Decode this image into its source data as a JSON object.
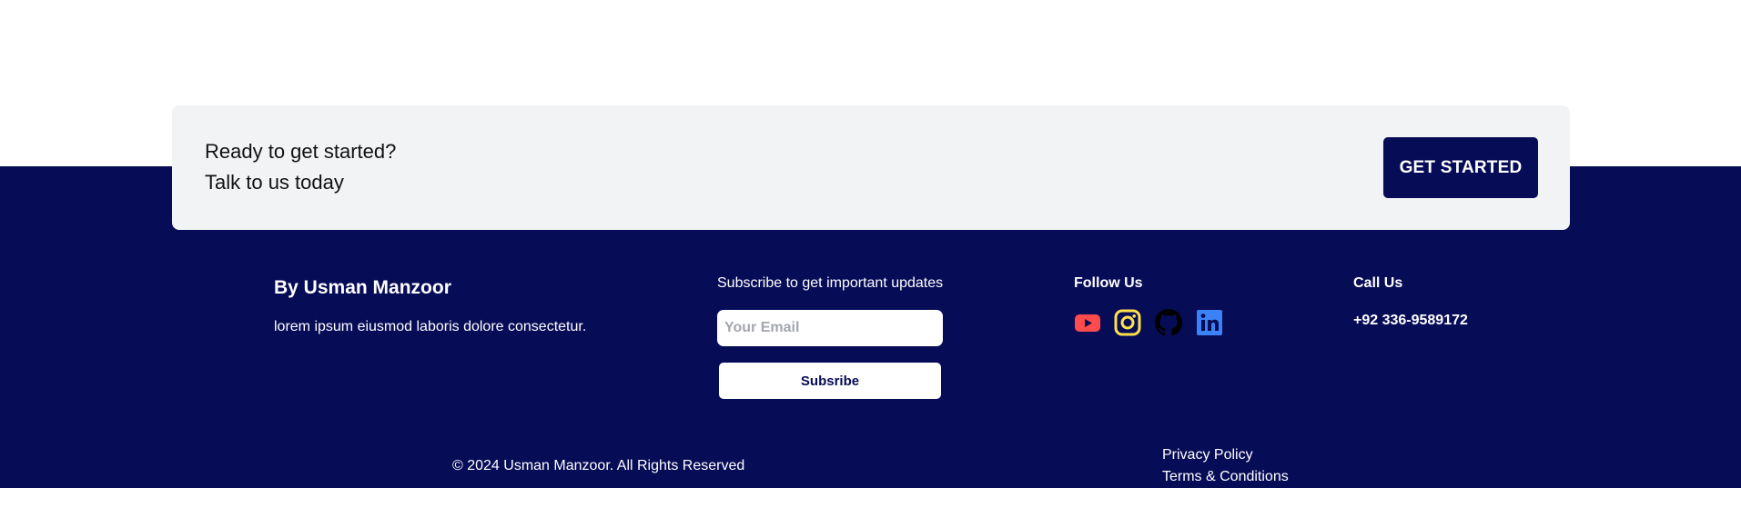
{
  "cta": {
    "line1": "Ready to get started?",
    "line2": "Talk to us today",
    "button_label": "GET STARTED"
  },
  "footer": {
    "brand": {
      "title": "By Usman Manzoor",
      "description": "lorem ipsum eiusmod laboris dolore consectetur."
    },
    "subscribe": {
      "heading": "Subscribe to get important updates",
      "email_placeholder": "Your Email",
      "email_value": "",
      "button_label": "Subsribe"
    },
    "follow": {
      "heading": "Follow Us",
      "icons": [
        {
          "name": "youtube-icon",
          "color": "#ff4b4b"
        },
        {
          "name": "instagram-icon",
          "color": "#ffe14d"
        },
        {
          "name": "github-icon",
          "color": "#000000"
        },
        {
          "name": "linkedin-icon",
          "color": "#3b82f6"
        }
      ]
    },
    "contact": {
      "heading": "Call Us",
      "phone": "+92 336-9589172"
    },
    "bottom": {
      "copyright": "© 2024 Usman Manzoor. All Rights Reserved",
      "links": [
        {
          "label": "Privacy Policy"
        },
        {
          "label": "Terms & Conditions"
        }
      ]
    }
  },
  "colors": {
    "brand_navy": "#070c57",
    "card_background": "#f2f3f5",
    "white": "#ffffff"
  }
}
